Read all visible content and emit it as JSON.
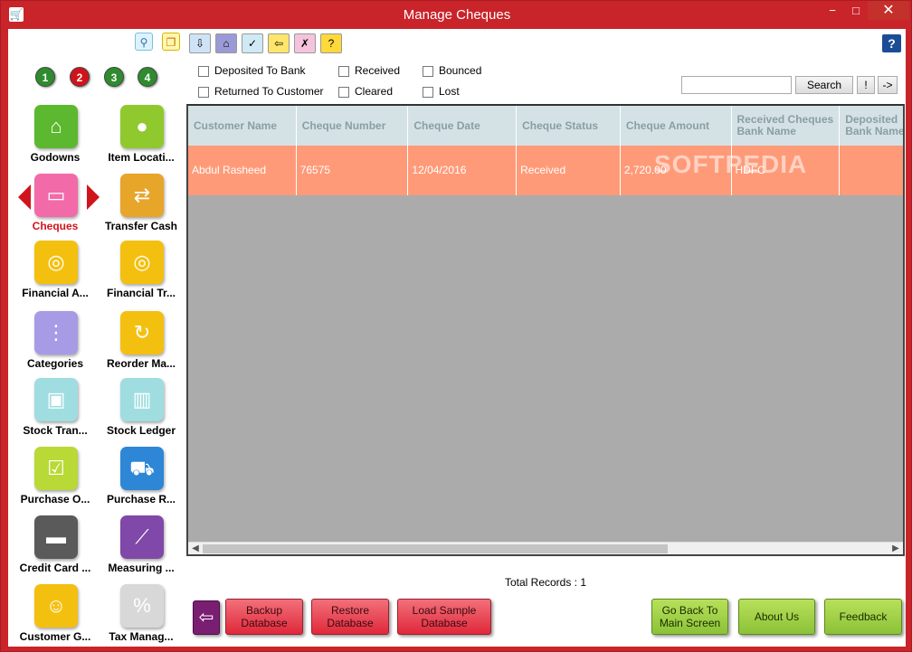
{
  "window": {
    "title": "Manage Cheques",
    "min_glyph": "−",
    "max_glyph": "□",
    "close_glyph": "✕"
  },
  "sidebar": {
    "numbers": [
      {
        "label": "1",
        "color": "#2e8b2e"
      },
      {
        "label": "2",
        "color": "#d0141c"
      },
      {
        "label": "3",
        "color": "#2e8b2e"
      },
      {
        "label": "4",
        "color": "#2e8b2e"
      }
    ],
    "items": [
      {
        "label": "Godowns",
        "icon": "house-icon",
        "glyph": "⌂",
        "color": "#5cb82e"
      },
      {
        "label": "Item Locati...",
        "icon": "location-pin-icon",
        "glyph": "●",
        "color": "#8fc92d"
      },
      {
        "label": "Cheques",
        "icon": "cheque-icon",
        "glyph": "▭",
        "color": "#f36aa8"
      },
      {
        "label": "Transfer Cash",
        "icon": "transfer-cash-icon",
        "glyph": "⇄",
        "color": "#e7a52a"
      },
      {
        "label": "Financial A...",
        "icon": "coins-icon",
        "glyph": "◎",
        "color": "#f4c010"
      },
      {
        "label": "Financial Tr...",
        "icon": "coins-transfer-icon",
        "glyph": "◎",
        "color": "#f4c010"
      },
      {
        "label": "Categories",
        "icon": "hierarchy-icon",
        "glyph": "⋮",
        "color": "#a79be6"
      },
      {
        "label": "Reorder Ma...",
        "icon": "recycle-icon",
        "glyph": "↻",
        "color": "#f4c010"
      },
      {
        "label": "Stock Tran...",
        "icon": "stock-transfer-icon",
        "glyph": "▣",
        "color": "#9fdde0"
      },
      {
        "label": "Stock Ledger",
        "icon": "bar-chart-icon",
        "glyph": "▥",
        "color": "#9fdde0"
      },
      {
        "label": "Purchase O...",
        "icon": "checklist-icon",
        "glyph": "☑",
        "color": "#b8d936"
      },
      {
        "label": "Purchase R...",
        "icon": "truck-icon",
        "glyph": "⛟",
        "color": "#2d86d6"
      },
      {
        "label": "Credit Card ...",
        "icon": "credit-card-icon",
        "glyph": "▬",
        "color": "#5a5a5a"
      },
      {
        "label": "Measuring ...",
        "icon": "ruler-icon",
        "glyph": "⟋",
        "color": "#8048a8"
      },
      {
        "label": "Customer G...",
        "icon": "users-icon",
        "glyph": "☺",
        "color": "#f4c010"
      },
      {
        "label": "Tax Manag...",
        "icon": "percent-icon",
        "glyph": "%",
        "color": "#d8d8d8"
      }
    ]
  },
  "toolbar": {
    "buttons": [
      {
        "icon": "deposit-icon",
        "glyph": "⇩",
        "bg": "#cfe3f7"
      },
      {
        "icon": "bank-icon",
        "glyph": "⌂",
        "bg": "#9a9ad6"
      },
      {
        "icon": "cheque-received-icon",
        "glyph": "✓",
        "bg": "#cfeaf5"
      },
      {
        "icon": "return-to-customer-icon",
        "glyph": "⇦",
        "bg": "#ffe66a"
      },
      {
        "icon": "cheque-bounced-icon",
        "glyph": "✗",
        "bg": "#f5c3dc"
      },
      {
        "icon": "cheque-lost-icon",
        "glyph": "?",
        "bg": "#ffd83a"
      }
    ],
    "help_label": "?"
  },
  "filters": {
    "deposited": "Deposited To Bank",
    "returned": "Returned To Customer",
    "received": "Received",
    "cleared": "Cleared",
    "bounced": "Bounced",
    "lost": "Lost"
  },
  "search": {
    "value": "",
    "button": "Search",
    "excl": "!",
    "go": "->"
  },
  "grid": {
    "columns": [
      {
        "label": "Customer Name",
        "w": 120
      },
      {
        "label": "Cheque Number",
        "w": 124
      },
      {
        "label": "Cheque Date",
        "w": 120
      },
      {
        "label": "Cheque Status",
        "w": 115
      },
      {
        "label": "Cheque Amount",
        "w": 123
      },
      {
        "label": "Received Cheques Bank Name",
        "w": 120
      },
      {
        "label": "Deposited Bank Name",
        "w": 80
      }
    ],
    "rows": [
      [
        "Abdul Rasheed",
        "76575",
        "12/04/2016",
        "Received",
        "2,720.00",
        "HDFC",
        ""
      ]
    ],
    "watermark": "SOFTPEDIA"
  },
  "total_records": "Total Records : 1",
  "bottom": {
    "back_glyph": "⇦",
    "backup": "Backup Database",
    "restore": "Restore Database",
    "load_sample": "Load Sample Database",
    "go_back": "Go Back To Main Screen",
    "about": "About Us",
    "feedback": "Feedback"
  }
}
